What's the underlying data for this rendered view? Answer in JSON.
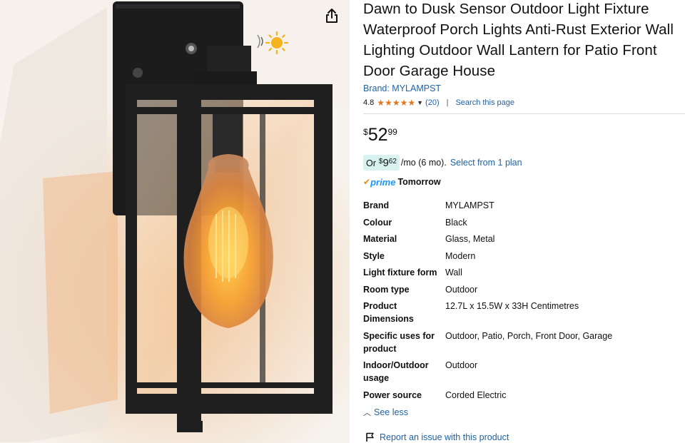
{
  "product": {
    "title": "Dawn to Dusk Sensor Outdoor Light Fixture Waterproof Porch Lights Anti-Rust Exterior Wall Lighting Outdoor Wall Lantern for Patio Front Door Garage House",
    "brand_link": "Brand: MYLAMPST",
    "rating": "4.8",
    "stars": 4.8,
    "rating_count": "(20)",
    "separator": "|",
    "search_page": "Search this page"
  },
  "price": {
    "currency": "$",
    "whole": "52",
    "fraction": "99"
  },
  "installment": {
    "prefix": "Or",
    "currency": "$",
    "whole": "9",
    "fraction": "62",
    "terms": "/mo (6 mo).",
    "plan_link": "Select from 1 plan"
  },
  "delivery": {
    "prime_label": "prime",
    "day": "Tomorrow"
  },
  "specs": [
    {
      "key": "Brand",
      "value": "MYLAMPST"
    },
    {
      "key": "Colour",
      "value": "Black"
    },
    {
      "key": "Material",
      "value": "Glass, Metal"
    },
    {
      "key": "Style",
      "value": "Modern"
    },
    {
      "key": "Light fixture form",
      "value": "Wall"
    },
    {
      "key": "Room type",
      "value": "Outdoor"
    },
    {
      "key": "Product Dimensions",
      "value": "12.7L x 15.5W x 33H Centimetres"
    },
    {
      "key": "Specific uses for product",
      "value": "Outdoor, Patio, Porch, Front Door, Garage"
    },
    {
      "key": "Indoor/Outdoor usage",
      "value": "Outdoor"
    },
    {
      "key": "Power source",
      "value": "Corded Electric"
    }
  ],
  "links": {
    "see_less": "See less",
    "report": "Report an issue with this product"
  },
  "icons": {
    "share": "share-icon",
    "star": "star-icon",
    "chevron": "chevron-down-icon",
    "prime_check": "prime-check-icon",
    "chevron_up": "chevron-up-icon",
    "flag": "flag-icon"
  },
  "colors": {
    "link": "#2162a1",
    "star": "#de7921",
    "installment_bg": "#d7f2ef",
    "prime_blue": "#1a98ff",
    "prime_orange": "#f08804"
  }
}
